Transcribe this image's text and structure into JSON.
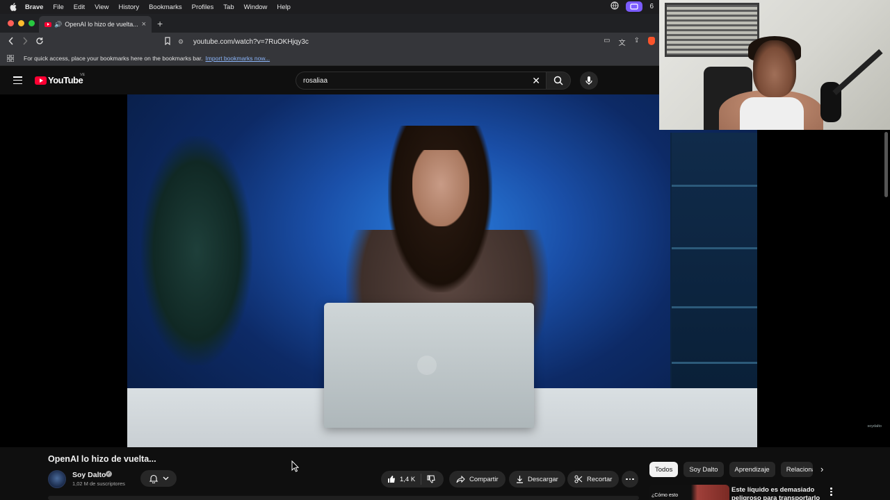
{
  "menubar": {
    "app": "Brave",
    "items": [
      "File",
      "Edit",
      "View",
      "History",
      "Bookmarks",
      "Profiles",
      "Tab",
      "Window",
      "Help"
    ],
    "badge_number": "6"
  },
  "browser": {
    "tab_title": "OpenAI lo hizo de vuelta...",
    "url": "youtube.com/watch?v=7RuOKHjqy3c",
    "bookmarks_hint": "For quick access, place your bookmarks here on the bookmarks bar.",
    "bookmarks_link": "Import bookmarks now..."
  },
  "youtube": {
    "logo_text": "YouTube",
    "country_code": "VE",
    "search_value": "rosaliaa"
  },
  "video": {
    "watermark": "soydalto"
  },
  "watch": {
    "title": "OpenAI lo hizo de vuelta...",
    "channel_name": "Soy Dalto",
    "subscribers": "1,02 M de suscriptores",
    "likes": "1,4 K",
    "share_label": "Compartir",
    "download_label": "Descargar",
    "clip_label": "Recortar"
  },
  "chips": [
    "Todos",
    "Soy Dalto",
    "Aprendizaje",
    "Relacionado"
  ],
  "recommendation": {
    "thumb_text": "¿Cómo esto",
    "title": "Este líquido es demasiado peligroso para transportarlo"
  }
}
